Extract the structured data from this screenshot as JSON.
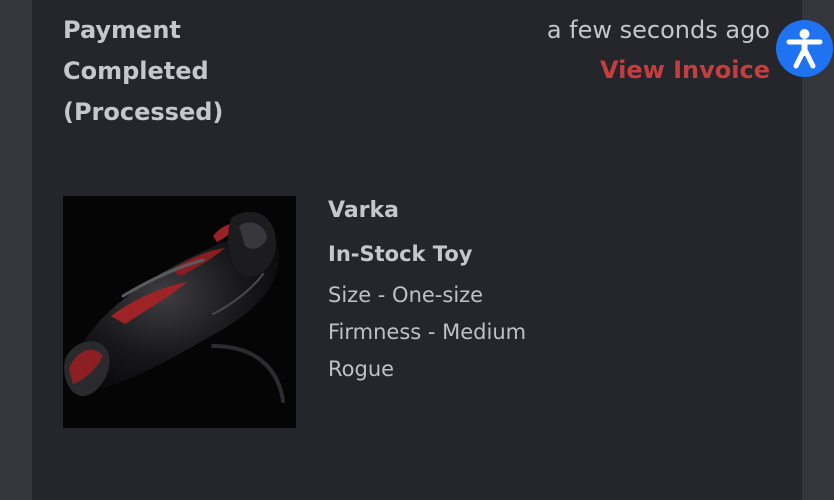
{
  "order": {
    "status_line1": "Payment",
    "status_line2": "Completed",
    "status_line3": "(Processed)",
    "timestamp": "a few seconds ago",
    "invoice_link": "View Invoice"
  },
  "product": {
    "name": "Varka",
    "type": "In-Stock Toy",
    "size": "Size - One-size",
    "firmness": "Firmness - Medium",
    "colorway": "Rogue",
    "image_icon": "product-photo"
  },
  "accessibility": {
    "icon": "accessibility-icon",
    "color": "#1f73f2"
  },
  "colors": {
    "background": "#34363c",
    "card": "#24262b",
    "text": "#c6c7cc",
    "accent": "#c63d3f"
  }
}
